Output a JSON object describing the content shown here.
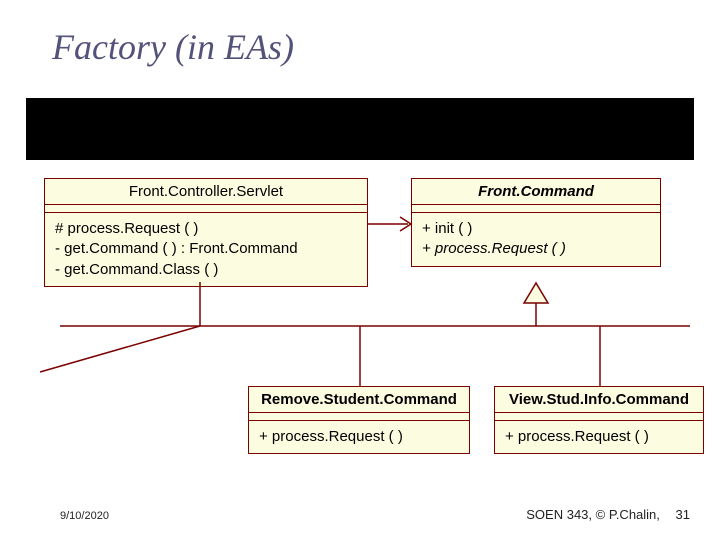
{
  "title": "Factory (in EAs)",
  "classes": {
    "front_controller_servlet": {
      "name": "Front.Controller.Servlet",
      "ops": [
        "# process.Request (  )",
        "- get.Command (  ) : Front.Command",
        " - get.Command.Class (  )"
      ]
    },
    "front_command": {
      "name": "Front.Command",
      "ops_line1": "+ init (  )",
      "ops_line2_italic": "+ process.Request (  )"
    },
    "remove_student_command": {
      "name": "Remove.Student.Command",
      "ops": "+ process.Request (  )"
    },
    "view_stud_info_command": {
      "name": "View.Stud.Info.Command",
      "ops": "+ process.Request (  )"
    }
  },
  "footer": {
    "date": "9/10/2020",
    "course": "SOEN 343, © P.Chalin,",
    "page": "31"
  }
}
